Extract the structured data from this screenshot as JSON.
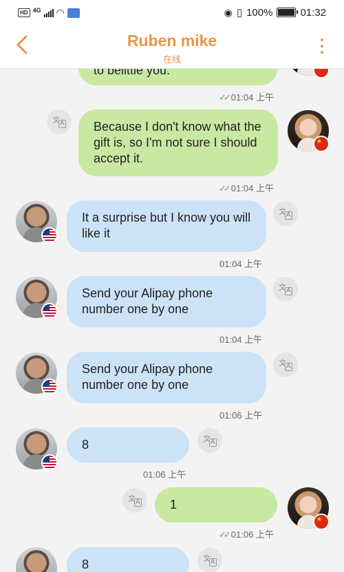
{
  "status": {
    "left": {
      "hd": "HD",
      "net": "4G"
    },
    "right": {
      "battery": "100%",
      "time": "01:32"
    }
  },
  "header": {
    "title": "Ruben mike",
    "subtitle": "在线"
  },
  "messages": [
    {
      "dir": "out",
      "text": "to belittle you.",
      "time": "01:04 上午"
    },
    {
      "dir": "out",
      "text": "Because I don't know what the gift is, so I'm not sure I should accept it.",
      "time": "01:04 上午"
    },
    {
      "dir": "in",
      "text": "It a surprise but I know you will like it",
      "time": "01:04 上午"
    },
    {
      "dir": "in",
      "text": "Send your Alipay phone number one by one",
      "time": "01:04 上午"
    },
    {
      "dir": "in",
      "text": "Send your Alipay phone number one by one",
      "time": "01:06 上午"
    },
    {
      "dir": "in",
      "text": "8",
      "time": "01:06 上午"
    },
    {
      "dir": "out",
      "text": "1",
      "time": "01:06 上午"
    },
    {
      "dir": "in",
      "text": "8",
      "time": ""
    }
  ],
  "colors": {
    "accent": "#e9944a",
    "out_bubble": "#c9e9a3",
    "in_bubble": "#cbe2f7",
    "read_check": "#5cae3e"
  }
}
